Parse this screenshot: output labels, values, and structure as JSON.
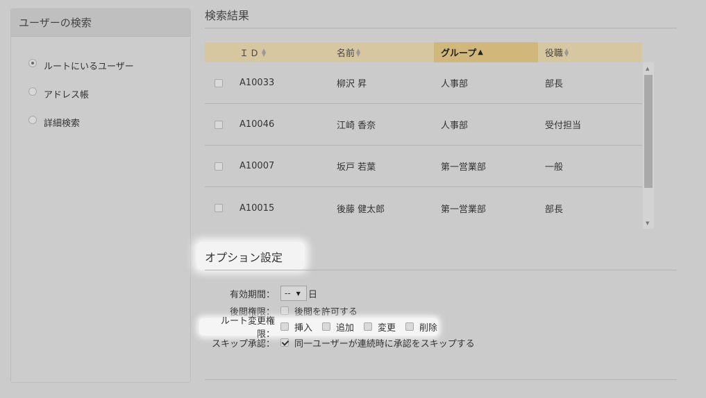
{
  "left": {
    "title": "ユーザーの検索",
    "options": [
      {
        "label": "ルートにいるユーザー",
        "checked": true
      },
      {
        "label": "アドレス帳",
        "checked": false
      },
      {
        "label": "詳細検索",
        "checked": false
      }
    ]
  },
  "results": {
    "title": "検索結果",
    "columns": [
      "ＩＤ",
      "名前",
      "グループ",
      "役職"
    ],
    "sorted_column": "グループ",
    "rows": [
      {
        "id": "A10033",
        "name": "柳沢 昇",
        "group": "人事部",
        "role": "部長"
      },
      {
        "id": "A10046",
        "name": "江崎 香奈",
        "group": "人事部",
        "role": "受付担当"
      },
      {
        "id": "A10007",
        "name": "坂戸 若葉",
        "group": "第一営業部",
        "role": "一般"
      },
      {
        "id": "A10015",
        "name": "後藤 健太郎",
        "group": "第一営業部",
        "role": "部長"
      }
    ]
  },
  "options": {
    "title": "オプション設定",
    "validity": {
      "label": "有効期間：",
      "value": "--",
      "unit": "日"
    },
    "snoop": {
      "label": "後閲権限：",
      "checkbox_label": "後閲を許可する",
      "checked": false
    },
    "route": {
      "label": "ルート変更権限：",
      "items": [
        {
          "label": "挿入",
          "checked": false
        },
        {
          "label": "追加",
          "checked": false
        },
        {
          "label": "変更",
          "checked": false
        },
        {
          "label": "削除",
          "checked": false
        }
      ]
    },
    "skip": {
      "label": "スキップ承認：",
      "checkbox_label": "同一ユーザーが連続時に承認をスキップする",
      "checked": true
    }
  }
}
